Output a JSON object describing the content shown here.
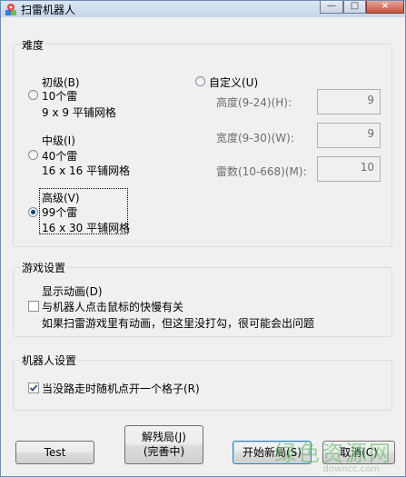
{
  "window": {
    "title": "扫雷机器人"
  },
  "title_buttons": {
    "minimize": "—",
    "maximize": "□",
    "close": "×"
  },
  "difficulty": {
    "label": "难度",
    "beginner": {
      "name": "初级(B)",
      "mines": "10个雷",
      "grid": "9 x 9 平铺网格",
      "selected": false
    },
    "intermediate": {
      "name": "中级(I)",
      "mines": "40个雷",
      "grid": "16 x 16 平铺网格",
      "selected": false
    },
    "expert": {
      "name": "高级(V)",
      "mines": "99个雷",
      "grid": "16 x 30 平铺网格",
      "selected": true
    },
    "custom": {
      "name": "自定义(U)",
      "height_label": "高度(9-24)(H):",
      "height_value": "9",
      "width_label": "宽度(9-30)(W):",
      "width_value": "9",
      "mines_label": "雷数(10-668)(M):",
      "mines_value": "10"
    }
  },
  "game_settings": {
    "label": "游戏设置",
    "animation_label": "显示动画(D)",
    "sync_label": "与机器人点击鼠标的快慢有关",
    "sync_checked": false,
    "note": "如果扫雷游戏里有动画，但这里没打勾，很可能会出问题"
  },
  "robot_settings": {
    "label": "机器人设置",
    "random_label": "当没路走时随机点开一个格子(R)",
    "random_checked": true
  },
  "buttons": {
    "test": "Test",
    "solve_line1": "解残局(J)",
    "solve_line2": "(完善中)",
    "new_game": "开始新局(S)",
    "cancel": "取消(C)"
  },
  "watermark": {
    "text": "绿色资源网",
    "sub": "downcc.com"
  }
}
